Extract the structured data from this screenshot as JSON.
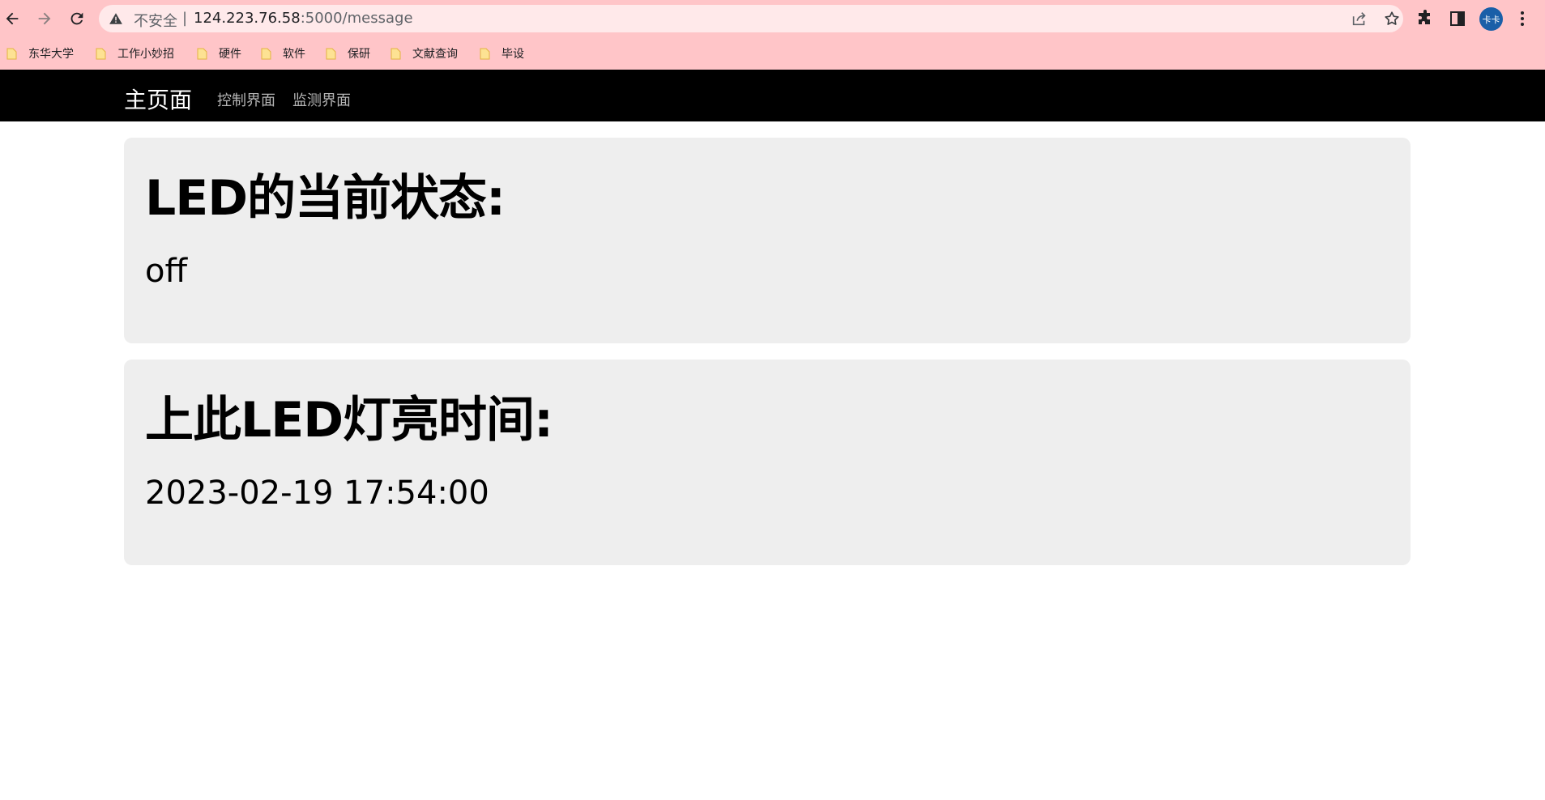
{
  "browser": {
    "insecure_label": "不安全",
    "separator": "|",
    "url_host": "124.223.76.58",
    "url_rest": ":5000/message",
    "avatar_text": "卡卡",
    "bookmarks": [
      {
        "label": "东华大学"
      },
      {
        "label": "工作小妙招"
      },
      {
        "label": "硬件"
      },
      {
        "label": "软件"
      },
      {
        "label": "保研"
      },
      {
        "label": "文献查询"
      },
      {
        "label": "毕设"
      }
    ]
  },
  "navbar": {
    "brand": "主页面",
    "links": [
      "控制界面",
      "监测界面"
    ]
  },
  "cards": [
    {
      "title": "LED的当前状态:",
      "value": "off"
    },
    {
      "title": "上此LED灯亮时间:",
      "value": "2023-02-19 17:54:00"
    }
  ],
  "colors": {
    "chrome_bg": "#ffc5c8",
    "omnibox_bg": "#ffe9ea",
    "navbar_bg": "#000000",
    "card_bg": "#eeeeee",
    "avatar_bg": "#1a5fa8"
  }
}
